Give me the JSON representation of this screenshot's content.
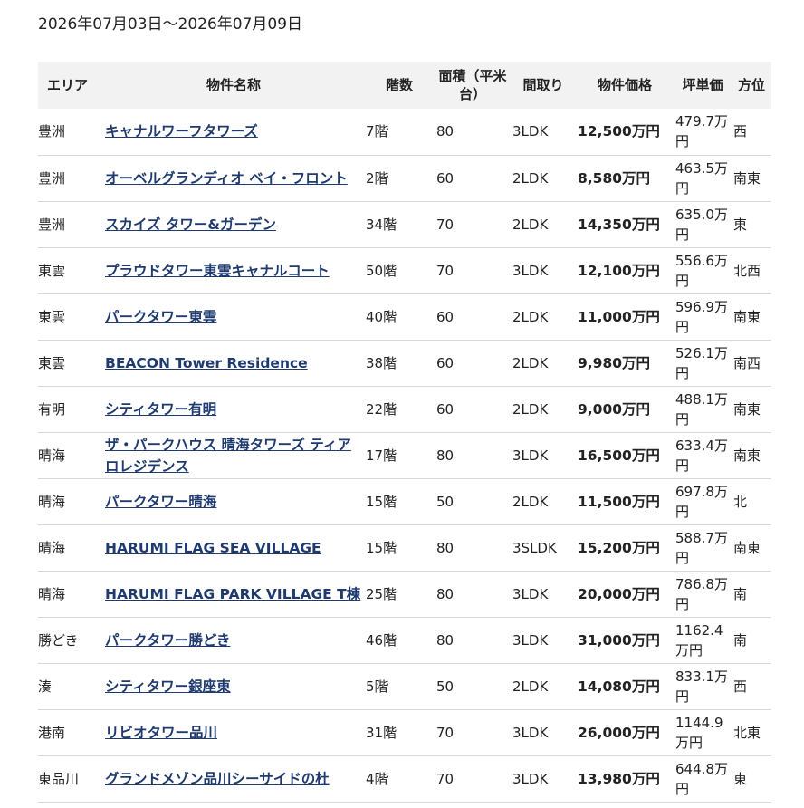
{
  "date_range": "2026年07月03日～2026年07月09日",
  "headers": {
    "area": "エリア",
    "name": "物件名称",
    "floor": "階数",
    "size": "面積（平米台）",
    "layout": "間取り",
    "price": "物件価格",
    "tsubo": "坪単価",
    "direction": "方位"
  },
  "rows": [
    {
      "area": "豊洲",
      "name": "キャナルワーフタワーズ",
      "floor": "7階",
      "size": "80",
      "layout": "3LDK",
      "price": "12,500万円",
      "tsubo": "479.7万円",
      "direction": "西"
    },
    {
      "area": "豊洲",
      "name": "オーベルグランディオ ベイ・フロント",
      "floor": "2階",
      "size": "60",
      "layout": "2LDK",
      "price": "8,580万円",
      "tsubo": "463.5万円",
      "direction": "南東"
    },
    {
      "area": "豊洲",
      "name": "スカイズ タワー&ガーデン",
      "floor": "34階",
      "size": "70",
      "layout": "2LDK",
      "price": "14,350万円",
      "tsubo": "635.0万円",
      "direction": "東"
    },
    {
      "area": "東雲",
      "name": "プラウドタワー東雲キャナルコート",
      "floor": "50階",
      "size": "70",
      "layout": "3LDK",
      "price": "12,100万円",
      "tsubo": "556.6万円",
      "direction": "北西"
    },
    {
      "area": "東雲",
      "name": "パークタワー東雲",
      "floor": "40階",
      "size": "60",
      "layout": "2LDK",
      "price": "11,000万円",
      "tsubo": "596.9万円",
      "direction": "南東"
    },
    {
      "area": "東雲",
      "name": "BEACON Tower Residence",
      "floor": "38階",
      "size": "60",
      "layout": "2LDK",
      "price": "9,980万円",
      "tsubo": "526.1万円",
      "direction": "南西"
    },
    {
      "area": "有明",
      "name": "シティタワー有明",
      "floor": "22階",
      "size": "60",
      "layout": "2LDK",
      "price": "9,000万円",
      "tsubo": "488.1万円",
      "direction": "南東"
    },
    {
      "area": "晴海",
      "name": "ザ・パークハウス 晴海タワーズ ティアロレジデンス",
      "floor": "17階",
      "size": "80",
      "layout": "3LDK",
      "price": "16,500万円",
      "tsubo": "633.4万円",
      "direction": "南東"
    },
    {
      "area": "晴海",
      "name": "パークタワー晴海",
      "floor": "15階",
      "size": "50",
      "layout": "2LDK",
      "price": "11,500万円",
      "tsubo": "697.8万円",
      "direction": "北"
    },
    {
      "area": "晴海",
      "name": "HARUMI FLAG SEA VILLAGE",
      "floor": "15階",
      "size": "80",
      "layout": "3SLDK",
      "price": "15,200万円",
      "tsubo": "588.7万円",
      "direction": "南東"
    },
    {
      "area": "晴海",
      "name": "HARUMI FLAG PARK VILLAGE T棟",
      "floor": "25階",
      "size": "80",
      "layout": "3LDK",
      "price": "20,000万円",
      "tsubo": "786.8万円",
      "direction": "南"
    },
    {
      "area": "勝どき",
      "name": "パークタワー勝どき",
      "floor": "46階",
      "size": "80",
      "layout": "3LDK",
      "price": "31,000万円",
      "tsubo": "1162.4万円",
      "direction": "南"
    },
    {
      "area": "湊",
      "name": "シティタワー銀座東",
      "floor": "5階",
      "size": "50",
      "layout": "2LDK",
      "price": "14,080万円",
      "tsubo": "833.1万円",
      "direction": "西"
    },
    {
      "area": "港南",
      "name": "リビオタワー品川",
      "floor": "31階",
      "size": "70",
      "layout": "3LDK",
      "price": "26,000万円",
      "tsubo": "1144.9万円",
      "direction": "北東"
    },
    {
      "area": "東品川",
      "name": "グランドメゾン品川シーサイドの杜",
      "floor": "4階",
      "size": "70",
      "layout": "3LDK",
      "price": "13,980万円",
      "tsubo": "644.8万円",
      "direction": "東"
    }
  ]
}
